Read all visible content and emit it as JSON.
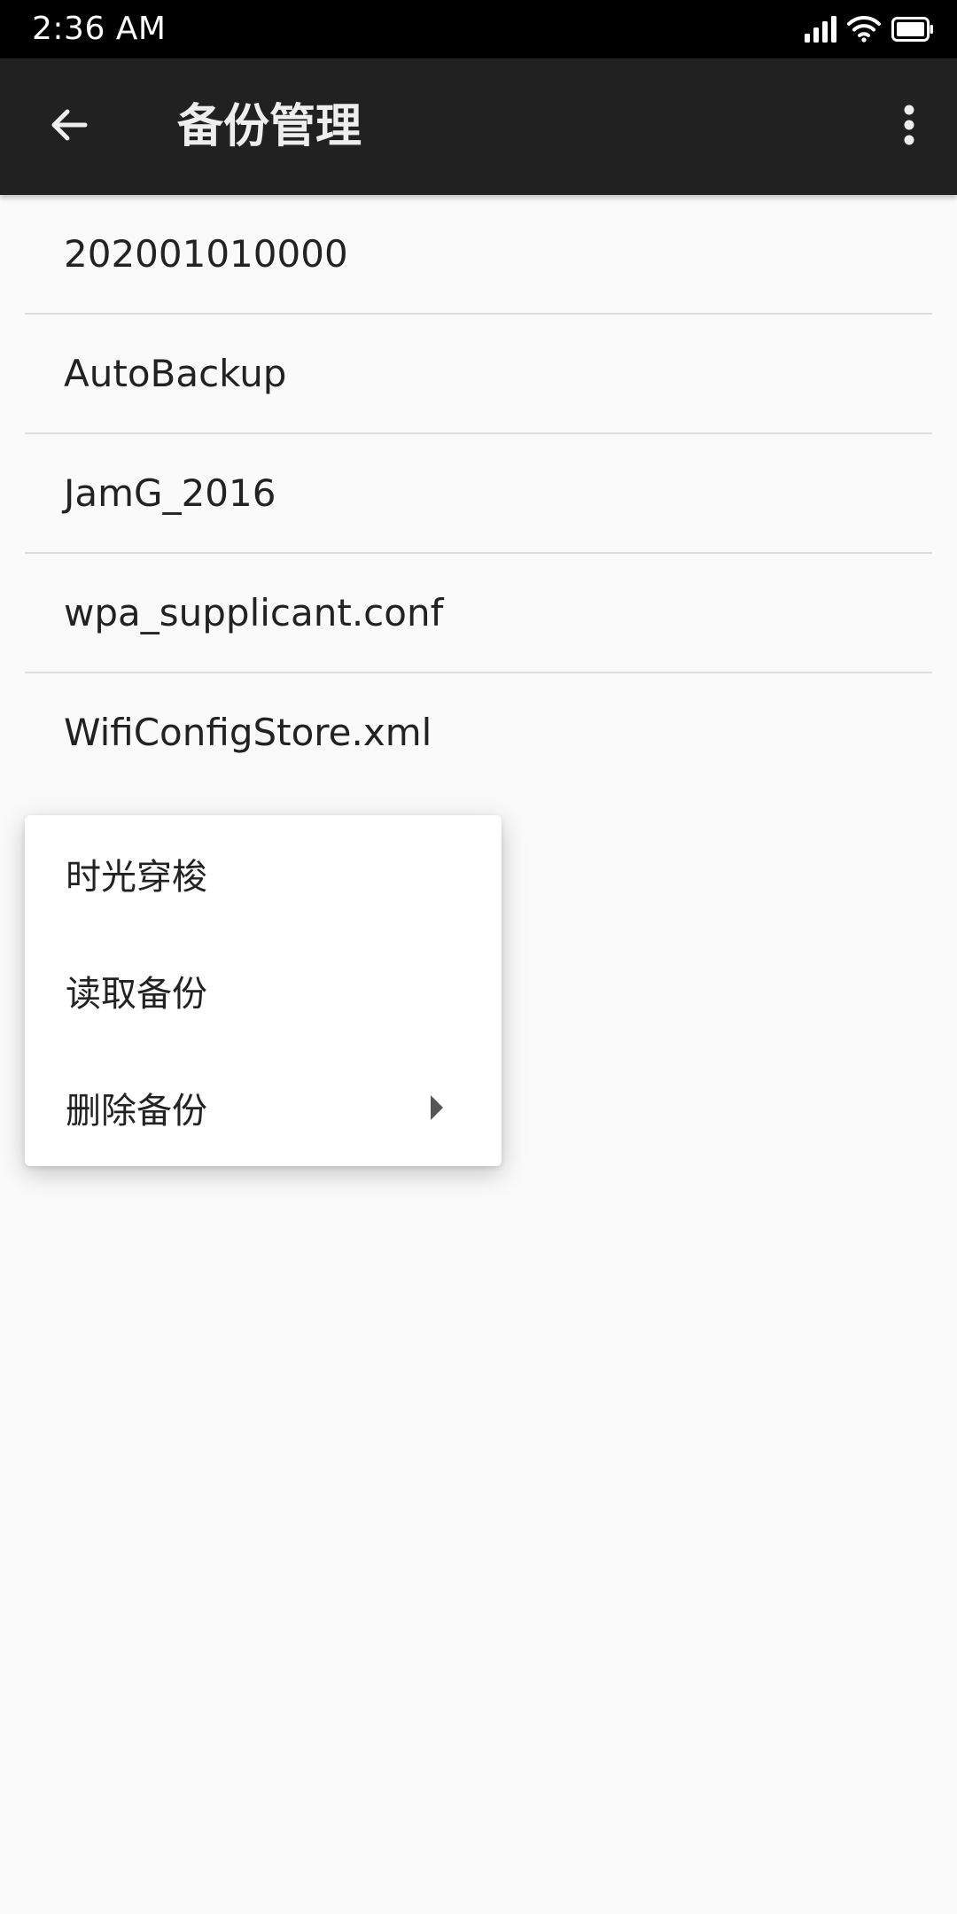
{
  "status_bar": {
    "time": "2:36 AM",
    "icons": [
      "signal-icon",
      "wifi-icon",
      "battery-icon"
    ]
  },
  "app_bar": {
    "title": "备份管理",
    "back_icon": "arrow-back-icon",
    "more_icon": "more-vert-icon"
  },
  "backups": {
    "items": [
      {
        "label": "202001010000"
      },
      {
        "label": "AutoBackup"
      },
      {
        "label": "JamG_2016"
      },
      {
        "label": "wpa_supplicant.conf"
      },
      {
        "label": "WifiConfigStore.xml"
      }
    ]
  },
  "menu": {
    "items": [
      {
        "label": "时光穿梭"
      },
      {
        "label": "读取备份"
      },
      {
        "label": "删除备份",
        "has_submenu": true
      }
    ]
  },
  "colors": {
    "status_bar_bg": "#000000",
    "app_bar_bg": "#212121",
    "background": "#fafafa",
    "divider": "#dedede",
    "text_primary": "#222222"
  }
}
